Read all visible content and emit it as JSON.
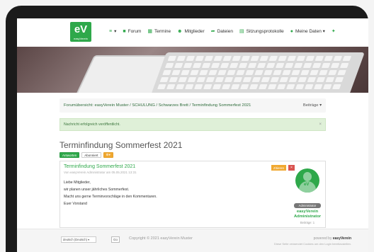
{
  "logo": {
    "text": "eV",
    "sub": "easyVerein"
  },
  "nav": {
    "items": [
      {
        "icon": "menu-icon",
        "label": "▾"
      },
      {
        "icon": "forum-icon",
        "label": "Forum"
      },
      {
        "icon": "calendar-icon",
        "label": "Termine"
      },
      {
        "icon": "users-icon",
        "label": "Mitglieder"
      },
      {
        "icon": "share-icon",
        "label": "Dateien"
      },
      {
        "icon": "file-icon",
        "label": "Sitzungsprotokolle"
      },
      {
        "icon": "user-icon",
        "label": "Meine Daten ▾"
      },
      {
        "icon": "person-run-icon",
        "label": ""
      }
    ]
  },
  "breadcrumb": {
    "text": "Forumübersicht: easyVerein Muster / SCHULUNG / Schwarzes Brett / Terminfindung Sommerfest 2021",
    "right": "Beiträge ▾"
  },
  "alert": {
    "text": "Nachricht erfolgreich veröffentlicht.",
    "close": "×"
  },
  "topic": {
    "title": "Terminfindung Sommerfest 2021"
  },
  "buttons": {
    "answer": "Antworten",
    "subscribed": "Abonniert",
    "tools": "▾"
  },
  "post": {
    "title": "Terminfindung Sommerfest 2021",
    "meta": "Von easyVerein Administrator am 05.05.2021 13:31",
    "lines": [
      "Liebe Mitglieder,",
      "wir planen unser jährliches Sommerfest.",
      "Macht uns gerne Terminvorschläge in den Kommentaren.",
      "Euer Vorstand"
    ],
    "quote": "Zitieren",
    "delete": "×"
  },
  "author": {
    "role": "Administrator",
    "name": "easyVerein Administrator",
    "posts": "Beiträge: 1"
  },
  "footer": {
    "language": "deutsch (Deutsch) ▾",
    "go": "Go",
    "copyright": "Copyright © 2021 easyVerein Muster",
    "powered_prefix": "powered by ",
    "powered_brand": "easyVerein",
    "cookie": "Diese Seite verwendet Cookies um den Login bereitzustellen."
  }
}
